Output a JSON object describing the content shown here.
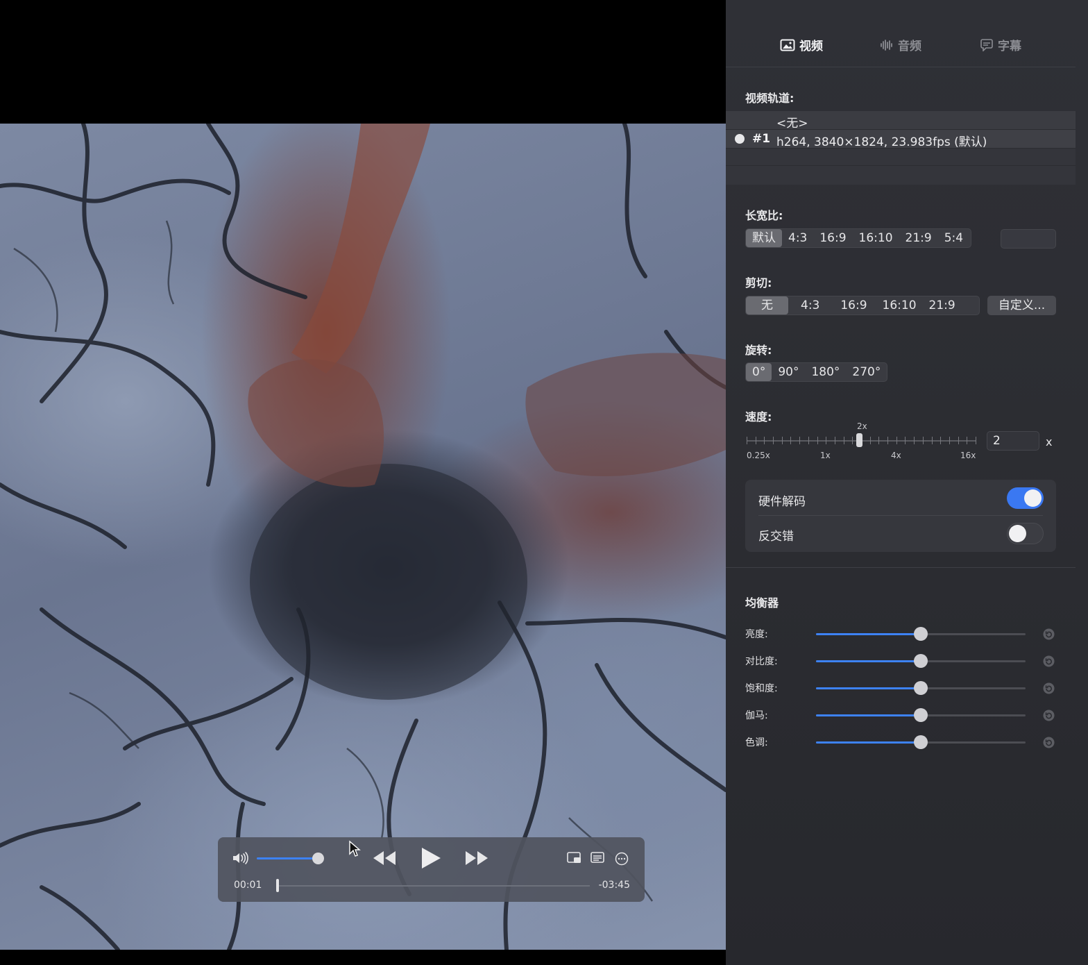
{
  "player": {
    "current_time": "00:01",
    "remaining_time": "-03:45",
    "volume_fraction": 1.0,
    "progress_fraction": 0.004
  },
  "tabs": [
    {
      "label": "视频",
      "icon": "photo-icon",
      "active": true
    },
    {
      "label": "音频",
      "icon": "waveform-icon",
      "active": false
    },
    {
      "label": "字幕",
      "icon": "speech-bubble-icon",
      "active": false
    }
  ],
  "video_track": {
    "label": "视频轨道:",
    "none_option": "<无>",
    "tracks": [
      {
        "id": "#1",
        "desc": "h264, 3840×1824, 23.983fps (默认)",
        "selected": true
      }
    ]
  },
  "aspect_ratio": {
    "label": "长宽比:",
    "options": [
      "默认",
      "4:3",
      "16:9",
      "16:10",
      "21:9",
      "5:4"
    ],
    "selected": "默认"
  },
  "crop": {
    "label": "剪切:",
    "options": [
      "无",
      "4:3",
      "16:9",
      "16:10",
      "21:9"
    ],
    "selected": "无",
    "custom_button": "自定义..."
  },
  "rotation": {
    "label": "旋转:",
    "options": [
      "0°",
      "90°",
      "180°",
      "270°"
    ],
    "selected": "0°"
  },
  "speed": {
    "label": "速度:",
    "marker_label": "2x",
    "scale_labels": [
      "0.25x",
      "1x",
      "4x",
      "16x"
    ],
    "value": "2",
    "unit": "x"
  },
  "toggles": {
    "hw_decode": {
      "label": "硬件解码",
      "on": true
    },
    "deinterlace": {
      "label": "反交错",
      "on": false
    }
  },
  "equalizer": {
    "title": "均衡器",
    "sliders": [
      {
        "label": "亮度:",
        "value": 0.5
      },
      {
        "label": "对比度:",
        "value": 0.5
      },
      {
        "label": "饱和度:",
        "value": 0.5
      },
      {
        "label": "伽马:",
        "value": 0.5
      },
      {
        "label": "色调:",
        "value": 0.5
      }
    ]
  },
  "colors": {
    "accent": "#3d82f5",
    "panel_bg": "#2e2f35",
    "toggle_on": "#3a78f2"
  }
}
